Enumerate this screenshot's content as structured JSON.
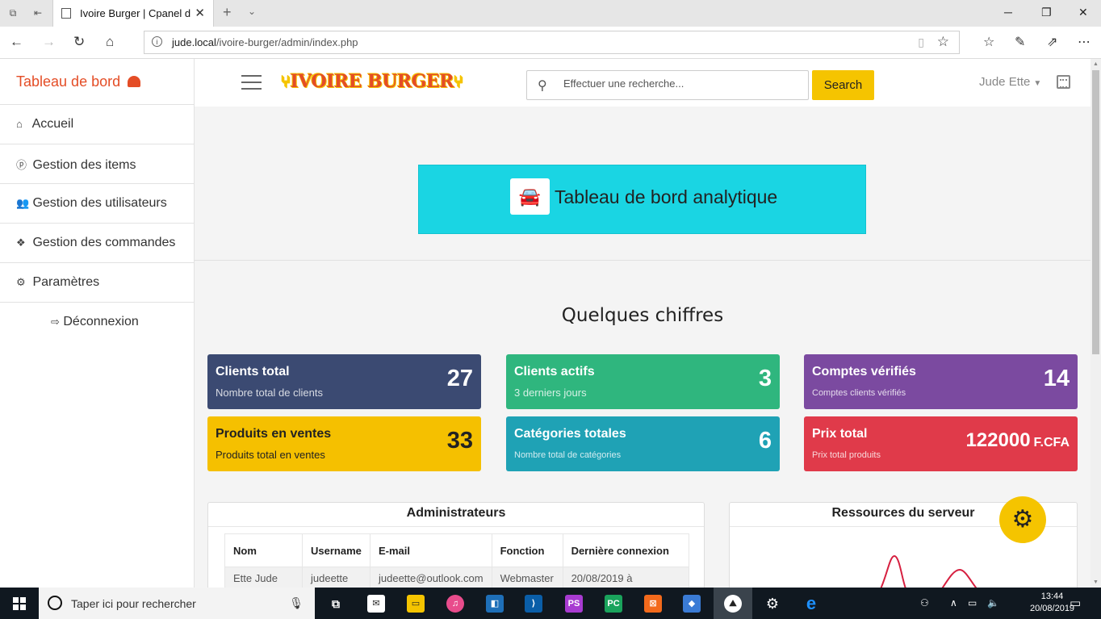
{
  "browser": {
    "tab_title": "Ivoire Burger | Cpanel d",
    "url_host": "jude.local",
    "url_path": "/ivoire-burger/admin/index.php"
  },
  "sidebar": {
    "brand": "Tableau de bord",
    "items": [
      {
        "label": "Accueil",
        "icon": "home-icon"
      },
      {
        "label": "Gestion des items",
        "icon": "product-hunt-icon"
      },
      {
        "label": "Gestion des utilisateurs",
        "icon": "users-icon"
      },
      {
        "label": "Gestion des commandes",
        "icon": "dropbox-icon"
      },
      {
        "label": "Paramètres",
        "icon": "cogs-icon"
      }
    ],
    "logout": "Déconnexion"
  },
  "header": {
    "logo": "IVOIRE BURGER",
    "search_placeholder": "Effectuer une recherche...",
    "search_button": "Search",
    "user_name": "Jude Ette"
  },
  "hero": {
    "title": "Tableau de bord analytique",
    "icon": "car-icon"
  },
  "stats": {
    "section_title": "Quelques chiffres",
    "cards": [
      {
        "label": "Clients total",
        "sub": "Nombre total de clients",
        "value": "27",
        "color": "#3b4a72"
      },
      {
        "label": "Clients actifs",
        "sub": "3 derniers jours",
        "value": "3",
        "color": "#2fb67e"
      },
      {
        "label": "Comptes vérifiés",
        "sub": "Comptes clients vérifiés",
        "value": "14",
        "color": "#7b4aa0"
      },
      {
        "label": "Produits en ventes",
        "sub": "Produits total en ventes",
        "value": "33",
        "color": "#f5c000"
      },
      {
        "label": "Catégories totales",
        "sub": "Nombre total de catégories",
        "value": "6",
        "color": "#1fa2b5"
      },
      {
        "label": "Prix total",
        "sub": "Prix total produits",
        "value": "122000",
        "unit": "F.CFA",
        "color": "#e03a4a"
      }
    ]
  },
  "admins": {
    "title": "Administrateurs",
    "columns": [
      "Nom",
      "Username",
      "E-mail",
      "Fonction",
      "Dernière connexion"
    ],
    "rows": [
      [
        "Ette Jude",
        "judeette",
        "judeette@outlook.com",
        "Webmaster",
        "20/08/2019 à"
      ]
    ]
  },
  "server": {
    "title": "Ressources du serveur"
  },
  "taskbar": {
    "search_text": "Taper ici pour rechercher",
    "time": "13:44",
    "date": "20/08/2019"
  }
}
